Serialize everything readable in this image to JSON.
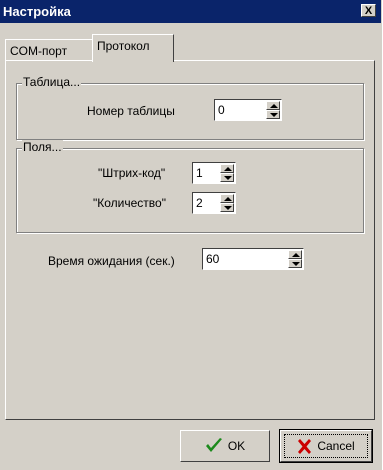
{
  "window": {
    "title": "Настройка",
    "close_symbol": "X"
  },
  "tabs": [
    {
      "label": "COM-порт",
      "active": false
    },
    {
      "label": "Протокол",
      "active": true
    }
  ],
  "table_group": {
    "legend": "Таблица...",
    "number_label": "Номер таблицы",
    "number_value": "0"
  },
  "fields_group": {
    "legend": "Поля...",
    "barcode_label": "\"Штрих-код\"",
    "barcode_value": "1",
    "quantity_label": "\"Количество\"",
    "quantity_value": "2"
  },
  "timeout": {
    "label": "Время ожидания (сек.)",
    "value": "60"
  },
  "buttons": {
    "ok": "OK",
    "cancel": "Cancel"
  },
  "colors": {
    "titlebar": "#0a246a",
    "face": "#d4d0c8",
    "ok_check": "#1c8a1c",
    "cancel_x": "#cc0000"
  }
}
